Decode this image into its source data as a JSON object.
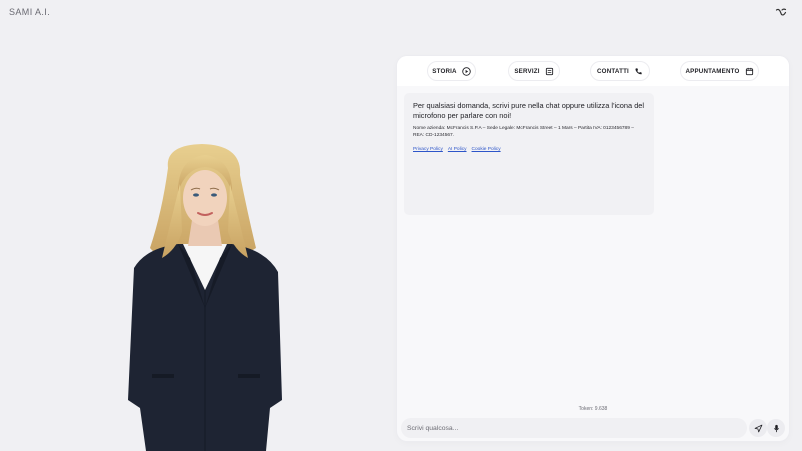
{
  "header": {
    "brand": "SAMI A.I.",
    "icon": "waves-icon"
  },
  "nav": [
    {
      "label": "STORIA",
      "icon": "play-circle-icon"
    },
    {
      "label": "SERVIZI",
      "icon": "services-box-icon"
    },
    {
      "label": "CONTATTI",
      "icon": "phone-icon"
    },
    {
      "label": "APPUNTAMENTO",
      "icon": "calendar-icon"
    }
  ],
  "bubble": {
    "message": "Per qualsiasi domanda, scrivi pure nella chat oppure utilizza l'icona del microfono per parlare con noi!",
    "company_info": "Nome azienda: McFrancis S.P.A – Sede Legale: McFrancis Street – 1 Mars – Partita IVA: 0123456789 – REA: CD-1234567.",
    "links": [
      "Privacy Policy",
      "AI Policy",
      "Cookie Policy"
    ]
  },
  "token_text": "Token: 9.638",
  "input": {
    "placeholder": "Scrivi qualcosa...",
    "value": ""
  },
  "actions": {
    "send_icon": "send-icon",
    "mic_icon": "microphone-icon"
  },
  "colors": {
    "background": "#f0f0f3",
    "panel": "#f8f8fa",
    "link": "#2d55c9",
    "suit": "#1e2433"
  }
}
